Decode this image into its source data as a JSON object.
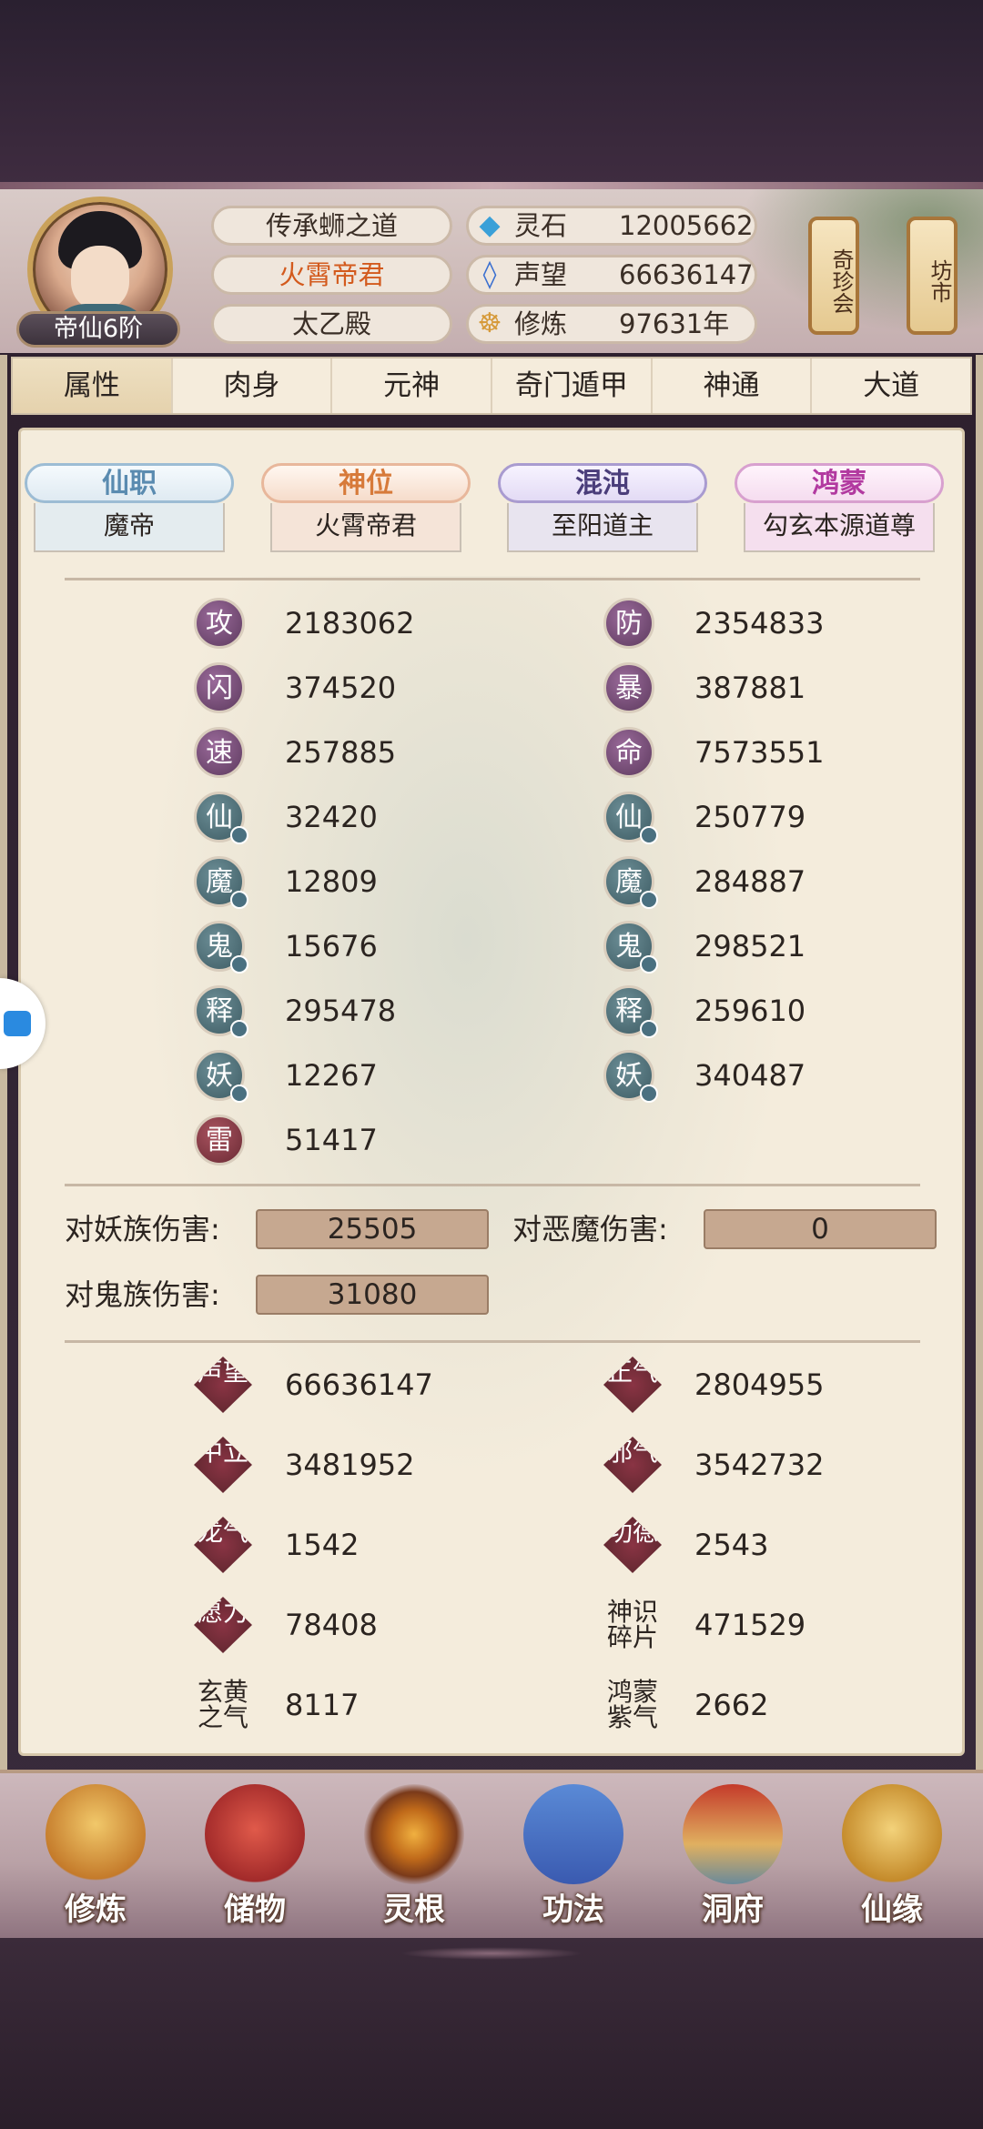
{
  "header": {
    "rank": "帝仙6阶",
    "titles": [
      "传承蛳之道",
      "火霄帝君",
      "太乙殿"
    ],
    "resources": [
      {
        "icon": "spirit-stone-icon",
        "label": "灵石",
        "value": "12005662"
      },
      {
        "icon": "reputation-crystal-icon",
        "label": "声望",
        "value": "66636147"
      },
      {
        "icon": "cultivation-meditation-icon",
        "label": "修炼",
        "value": "97631年"
      }
    ],
    "side_buttons": [
      "奇珍会",
      "坊市"
    ]
  },
  "tabs": [
    {
      "label": "属性",
      "active": true
    },
    {
      "label": "肉身",
      "active": false
    },
    {
      "label": "元神",
      "active": false
    },
    {
      "label": "奇门遁甲",
      "active": false
    },
    {
      "label": "神通",
      "active": false
    },
    {
      "label": "大道",
      "active": false
    }
  ],
  "plaques": [
    {
      "title": "仙职",
      "value": "魔帝"
    },
    {
      "title": "神位",
      "value": "火霄帝君"
    },
    {
      "title": "混沌",
      "value": "至阳道主"
    },
    {
      "title": "鸿蒙",
      "value": "勾玄本源道尊"
    }
  ],
  "stats_left": [
    {
      "glyph": "攻",
      "value": "2183062"
    },
    {
      "glyph": "闪",
      "value": "374520"
    },
    {
      "glyph": "速",
      "value": "257885"
    },
    {
      "glyph": "仙",
      "value": "32420"
    },
    {
      "glyph": "魔",
      "value": "12809"
    },
    {
      "glyph": "鬼",
      "value": "15676"
    },
    {
      "glyph": "释",
      "value": "295478"
    },
    {
      "glyph": "妖",
      "value": "12267"
    },
    {
      "glyph": "雷",
      "value": "51417"
    }
  ],
  "stats_right": [
    {
      "glyph": "防",
      "value": "2354833"
    },
    {
      "glyph": "暴",
      "value": "387881"
    },
    {
      "glyph": "命",
      "value": "7573551"
    },
    {
      "glyph": "仙",
      "value": "250779"
    },
    {
      "glyph": "魔",
      "value": "284887"
    },
    {
      "glyph": "鬼",
      "value": "298521"
    },
    {
      "glyph": "释",
      "value": "259610"
    },
    {
      "glyph": "妖",
      "value": "340487"
    }
  ],
  "damage": [
    {
      "label": "对妖族伤害:",
      "value": "25505"
    },
    {
      "label": "对恶魔伤害:",
      "value": "0"
    },
    {
      "label": "对鬼族伤害:",
      "value": "31080"
    }
  ],
  "reputation_left": [
    {
      "label": "声望",
      "value": "66636147"
    },
    {
      "label": "中立",
      "value": "3481952"
    },
    {
      "label": "龙气",
      "value": "1542"
    },
    {
      "label": "愿力",
      "value": "78408"
    },
    {
      "label": "玄黄之气",
      "value": "8117"
    }
  ],
  "reputation_right": [
    {
      "label": "正气",
      "value": "2804955"
    },
    {
      "label": "邪气",
      "value": "3542732"
    },
    {
      "label": "功德",
      "value": "2543"
    },
    {
      "label": "神识碎片",
      "value": "471529"
    },
    {
      "label": "鸿蒙紫气",
      "value": "2662"
    }
  ],
  "bottom_nav": [
    {
      "label": "修炼",
      "icon": "meditating-monk-icon"
    },
    {
      "label": "储物",
      "icon": "storage-bag-icon"
    },
    {
      "label": "灵根",
      "icon": "spirit-root-icon"
    },
    {
      "label": "功法",
      "icon": "manual-book-icon"
    },
    {
      "label": "洞府",
      "icon": "cave-dwelling-icon"
    },
    {
      "label": "仙缘",
      "icon": "gourd-icon"
    }
  ]
}
